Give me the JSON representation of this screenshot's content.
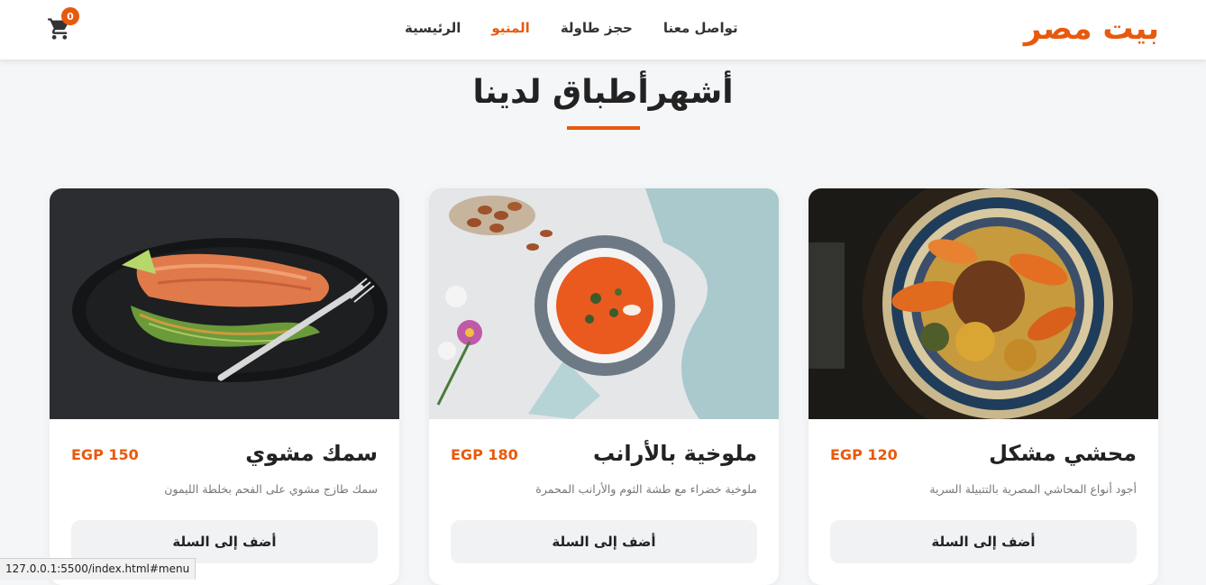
{
  "header": {
    "brand": "بيت مصر",
    "nav": [
      {
        "label": "الرئيسية",
        "active": false
      },
      {
        "label": "المنيو",
        "active": true
      },
      {
        "label": "حجز طاولة",
        "active": false
      },
      {
        "label": "تواصل معنا",
        "active": false
      }
    ],
    "cart_count": "0",
    "cart_icon": "cart-icon",
    "accent_color": "#e8590c"
  },
  "section": {
    "title": "أشهرأطباق لدينا"
  },
  "cards": [
    {
      "name": "محشي مشكل",
      "price": "EGP 120",
      "description": "أجود أنواع المحاشي المصرية بالتتبيلة السرية",
      "button": "أضف إلى السلة"
    },
    {
      "name": "ملوخية بالأرانب",
      "price": "EGP 180",
      "description": "ملوخية خضراء مع طشة الثوم والأرانب المحمرة",
      "button": "أضف إلى السلة"
    },
    {
      "name": "سمك مشوي",
      "price": "EGP 150",
      "description": "سمك طازج مشوي على الفحم بخلطة الليمون",
      "button": "أضف إلى السلة"
    }
  ],
  "status_bar": {
    "url": "127.0.0.1:5500/index.html#menu"
  }
}
